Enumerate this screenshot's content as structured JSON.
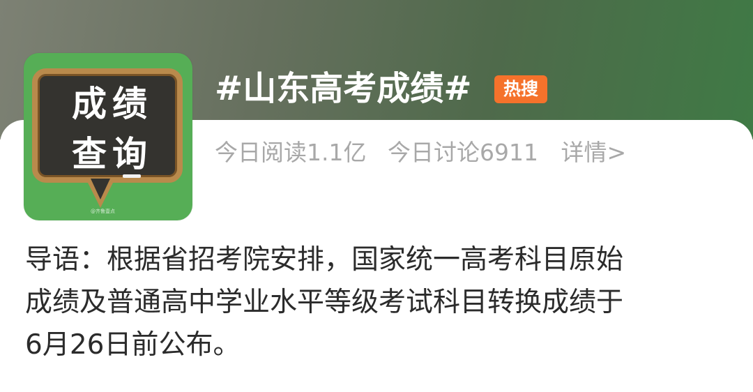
{
  "topic": {
    "image": {
      "line1": "成绩",
      "line2": "查询",
      "watermark": "@齐鲁壹点"
    },
    "title": "#山东高考成绩#",
    "badge": "热搜"
  },
  "stats": {
    "reads": "今日阅读1.1亿",
    "discussions": "今日讨论6911",
    "details": "详情>"
  },
  "intro": {
    "lines": [
      "导语：根据省招考院安排，国家统一高考科目原始",
      "成绩及普通高中学业水平等级考试科目转换成绩于",
      "6月26日前公布。"
    ]
  },
  "colors": {
    "header_green": "#3f7a45",
    "badge_orange": "#f5722b",
    "image_green": "#56ae56"
  }
}
